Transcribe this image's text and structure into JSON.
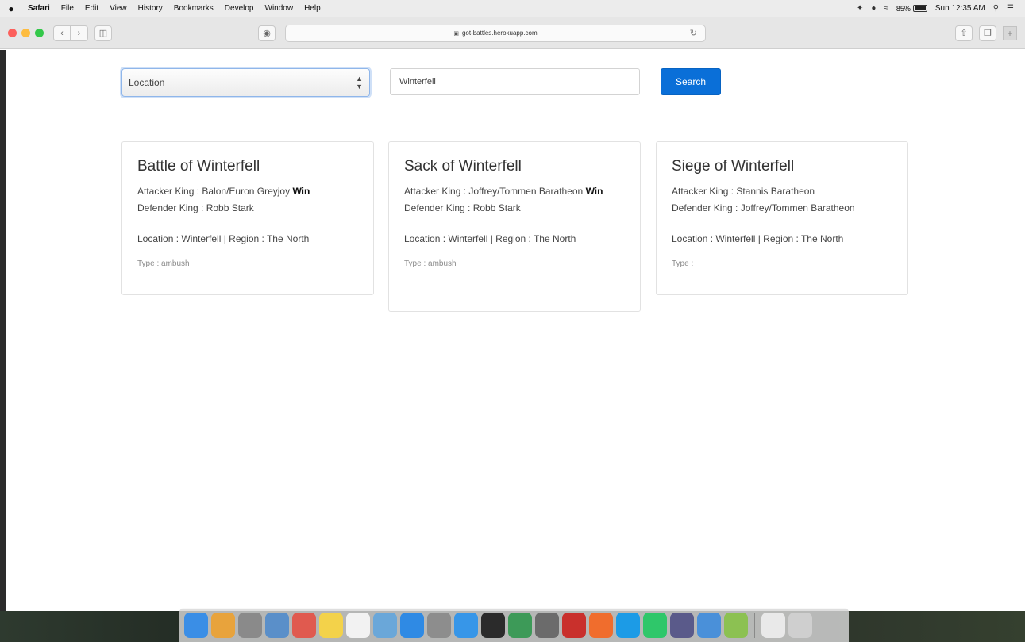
{
  "menubar": {
    "apple": "",
    "items": [
      "Safari",
      "File",
      "Edit",
      "View",
      "History",
      "Bookmarks",
      "Develop",
      "Window",
      "Help"
    ],
    "battery": "85%",
    "clock": "Sun 12:35 AM"
  },
  "toolbar": {
    "url": "got-battles.herokuapp.com",
    "traffic_colors": [
      "#fc605c",
      "#fdbc40",
      "#34c84a"
    ]
  },
  "search": {
    "select_value": "Location",
    "input_value": "Winterfell",
    "button_label": "Search"
  },
  "cards": [
    {
      "title": "Battle of Winterfell",
      "attacker": "Attacker King : Balon/Euron Greyjoy",
      "attacker_win": "Win",
      "defender": "Defender King : Robb Stark",
      "defender_win": "",
      "location": "Location : Winterfell | Region : The North",
      "type": "Type : ambush"
    },
    {
      "title": "Sack of Winterfell",
      "attacker": "Attacker King : Joffrey/Tommen Baratheon",
      "attacker_win": "Win",
      "defender": "Defender King : Robb Stark",
      "defender_win": "",
      "location": "Location : Winterfell | Region : The North",
      "type": "Type : ambush"
    },
    {
      "title": "Siege of Winterfell",
      "attacker": "Attacker King : Stannis Baratheon",
      "attacker_win": "",
      "defender": "Defender King : Joffrey/Tommen Baratheon",
      "defender_win": "",
      "location": "Location : Winterfell | Region : The North",
      "type": "Type :"
    }
  ],
  "dock": {
    "apps": [
      {
        "name": "finder",
        "color": "#3a8ee6"
      },
      {
        "name": "chrome",
        "color": "#e8a33c"
      },
      {
        "name": "launchpad",
        "color": "#8a8a8a"
      },
      {
        "name": "preview",
        "color": "#5a8fc9"
      },
      {
        "name": "calendar",
        "color": "#e05a4f"
      },
      {
        "name": "notes",
        "color": "#f3d24a"
      },
      {
        "name": "reminders",
        "color": "#f2f2f2"
      },
      {
        "name": "photos",
        "color": "#6aa7d9"
      },
      {
        "name": "app-store",
        "color": "#2f8ae4"
      },
      {
        "name": "system-preferences",
        "color": "#8d8d8d"
      },
      {
        "name": "safari",
        "color": "#3796e8"
      },
      {
        "name": "terminal",
        "color": "#2b2b2b"
      },
      {
        "name": "sourcetree",
        "color": "#3d9a58"
      },
      {
        "name": "sublime-text",
        "color": "#6b6b6b"
      },
      {
        "name": "filezilla",
        "color": "#c9302c"
      },
      {
        "name": "postman",
        "color": "#f06d2d"
      },
      {
        "name": "skype",
        "color": "#1c9be6"
      },
      {
        "name": "whatsapp",
        "color": "#2fc76a"
      },
      {
        "name": "vpn",
        "color": "#5a5a8a"
      },
      {
        "name": "xcode",
        "color": "#4a90d9"
      },
      {
        "name": "android-file-transfer",
        "color": "#8cc152"
      },
      {
        "name": "documents",
        "color": "#e9e9e9"
      },
      {
        "name": "trash",
        "color": "#cfcfcf"
      }
    ]
  }
}
